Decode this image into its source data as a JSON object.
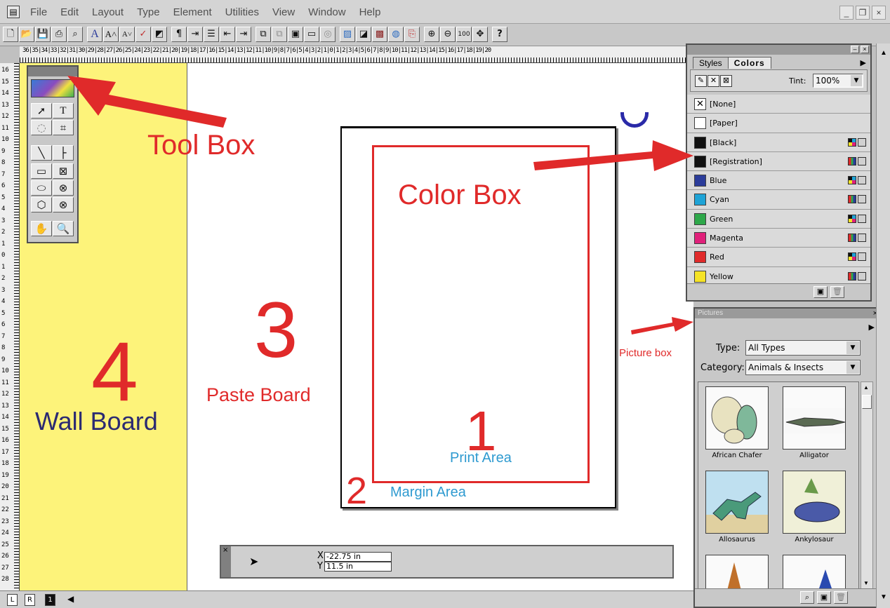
{
  "menubar": {
    "items": [
      "File",
      "Edit",
      "Layout",
      "Type",
      "Element",
      "Utilities",
      "View",
      "Window",
      "Help"
    ],
    "minimize": "_",
    "restore": "❐",
    "close": "×"
  },
  "rulers": {
    "horizontal_ticks": "36|35|34|33|32|31|30|29|28|27|26|25|24|23|22|21|20|19|18|17|16|15|14|13|12|11|10|9|8|7|6|5|4|3|2|1|0|1|2|3|4|5|6|7|8|9|10|11|12|13|14|15|16|17|18|19|20",
    "vertical_ticks": [
      "16",
      "15",
      "14",
      "13",
      "12",
      "11",
      "10",
      "9",
      "8",
      "7",
      "6",
      "5",
      "4",
      "3",
      "2",
      "1",
      "0",
      "1",
      "2",
      "3",
      "4",
      "5",
      "6",
      "7",
      "8",
      "9",
      "10",
      "11",
      "12",
      "13",
      "14",
      "15",
      "16",
      "17",
      "18",
      "19",
      "20",
      "21",
      "22",
      "23",
      "24",
      "25",
      "26",
      "27",
      "28"
    ]
  },
  "annotations": {
    "toolbox_label": "Tool Box",
    "colorbox_label": "Color Box",
    "picturebox_label": "Picture box",
    "num_1": "1",
    "num_2": "2",
    "num_3": "3",
    "num_4": "4",
    "print_area": "Print Area",
    "margin_area": "Margin Area",
    "paste_board": "Paste Board",
    "wall_board": "Wall Board"
  },
  "colors_panel": {
    "tab_styles": "Styles",
    "tab_colors": "Colors",
    "tint_label": "Tint:",
    "tint_value": "100%",
    "colors": [
      {
        "name": "[None]",
        "hex": "#ffffff",
        "none": true
      },
      {
        "name": "[Paper]",
        "hex": "#ffffff"
      },
      {
        "name": "[Black]",
        "hex": "#111111"
      },
      {
        "name": "[Registration]",
        "hex": "#111111"
      },
      {
        "name": "Blue",
        "hex": "#2b3c9a"
      },
      {
        "name": "Cyan",
        "hex": "#1ea3d6"
      },
      {
        "name": "Green",
        "hex": "#2ea84a"
      },
      {
        "name": "Magenta",
        "hex": "#e0207a"
      },
      {
        "name": "Red",
        "hex": "#e02a2a"
      },
      {
        "name": "Yellow",
        "hex": "#f5e326"
      }
    ]
  },
  "pictures_panel": {
    "title": "Pictures",
    "type_label": "Type:",
    "type_value": "All Types",
    "category_label": "Category:",
    "category_value": "Animals & Insects",
    "items": [
      "African Chafer",
      "Alligator",
      "Allosaurus",
      "Ankylosaur"
    ]
  },
  "measurements": {
    "x_label": "X",
    "x_value": "-22.75 in",
    "y_label": "Y",
    "y_value": "11.5 in"
  },
  "page_tabs": {
    "left": "L",
    "right": "R",
    "current": "1"
  },
  "accent": {
    "annotation_red": "#e02a2a",
    "annotation_blue": "#2e9ad0",
    "wallboard_yellow": "#fdf37a",
    "wallboard_text": "#2b2a72"
  }
}
